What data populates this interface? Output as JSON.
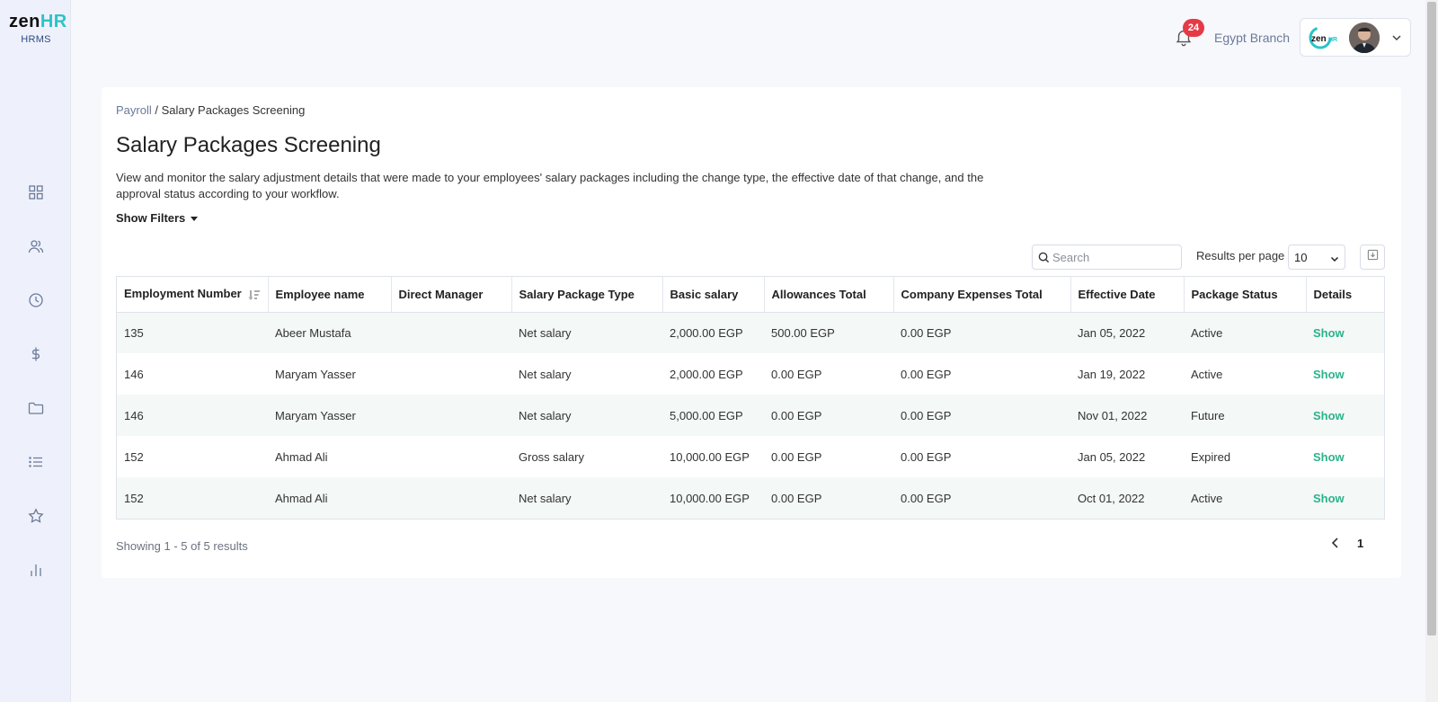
{
  "app": {
    "logo_zen": "zen",
    "logo_hr": "HR",
    "logo_sub": "HRMS"
  },
  "sidebar": {
    "items": [
      {
        "icon": "dashboard-grid-icon"
      },
      {
        "icon": "users-icon"
      },
      {
        "icon": "clock-icon"
      },
      {
        "icon": "dollar-icon"
      },
      {
        "icon": "folder-icon"
      },
      {
        "icon": "list-icon"
      },
      {
        "icon": "star-icon"
      },
      {
        "icon": "bar-chart-icon"
      }
    ]
  },
  "header": {
    "notification_count": "24",
    "branch": "Egypt Branch"
  },
  "breadcrumb": {
    "parent": "Payroll",
    "separator": " / ",
    "current": "Salary Packages Screening"
  },
  "page": {
    "title": "Salary Packages Screening",
    "description": "View and monitor the salary adjustment details that were made to your employees' salary packages including the change type, the effective date of that change, and the approval status according to your workflow.",
    "show_filters": "Show Filters"
  },
  "toolbar": {
    "search_placeholder": "Search",
    "results_per_page_label": "Results per page",
    "results_per_page_value": "10"
  },
  "table": {
    "columns": [
      "Employment Number",
      "Employee name",
      "Direct Manager",
      "Salary Package Type",
      "Basic salary",
      "Allowances Total",
      "Company Expenses Total",
      "Effective Date",
      "Package Status",
      "Details"
    ],
    "rows": [
      {
        "emp_no": "135",
        "name": "Abeer Mustafa",
        "manager": "",
        "type": "Net salary",
        "basic": "2,000.00 EGP",
        "allowances": "500.00 EGP",
        "expenses": "0.00 EGP",
        "date": "Jan 05, 2022",
        "status": "Active",
        "details": "Show"
      },
      {
        "emp_no": "146",
        "name": "Maryam Yasser",
        "manager": "",
        "type": "Net salary",
        "basic": "2,000.00 EGP",
        "allowances": "0.00 EGP",
        "expenses": "0.00 EGP",
        "date": "Jan 19, 2022",
        "status": "Active",
        "details": "Show"
      },
      {
        "emp_no": "146",
        "name": "Maryam Yasser",
        "manager": "",
        "type": "Net salary",
        "basic": "5,000.00 EGP",
        "allowances": "0.00 EGP",
        "expenses": "0.00 EGP",
        "date": "Nov 01, 2022",
        "status": "Future",
        "details": "Show"
      },
      {
        "emp_no": "152",
        "name": "Ahmad Ali",
        "manager": "",
        "type": "Gross salary",
        "basic": "10,000.00 EGP",
        "allowances": "0.00 EGP",
        "expenses": "0.00 EGP",
        "date": "Jan 05, 2022",
        "status": "Expired",
        "details": "Show"
      },
      {
        "emp_no": "152",
        "name": "Ahmad Ali",
        "manager": "",
        "type": "Net salary",
        "basic": "10,000.00 EGP",
        "allowances": "0.00 EGP",
        "expenses": "0.00 EGP",
        "date": "Oct 01, 2022",
        "status": "Active",
        "details": "Show"
      }
    ]
  },
  "footer": {
    "showing": "Showing 1 - 5 of 5 results",
    "page": "1"
  },
  "colors": {
    "accent": "#2bb38a",
    "brand_teal": "#2bc3c9",
    "badge_red": "#e63946"
  }
}
